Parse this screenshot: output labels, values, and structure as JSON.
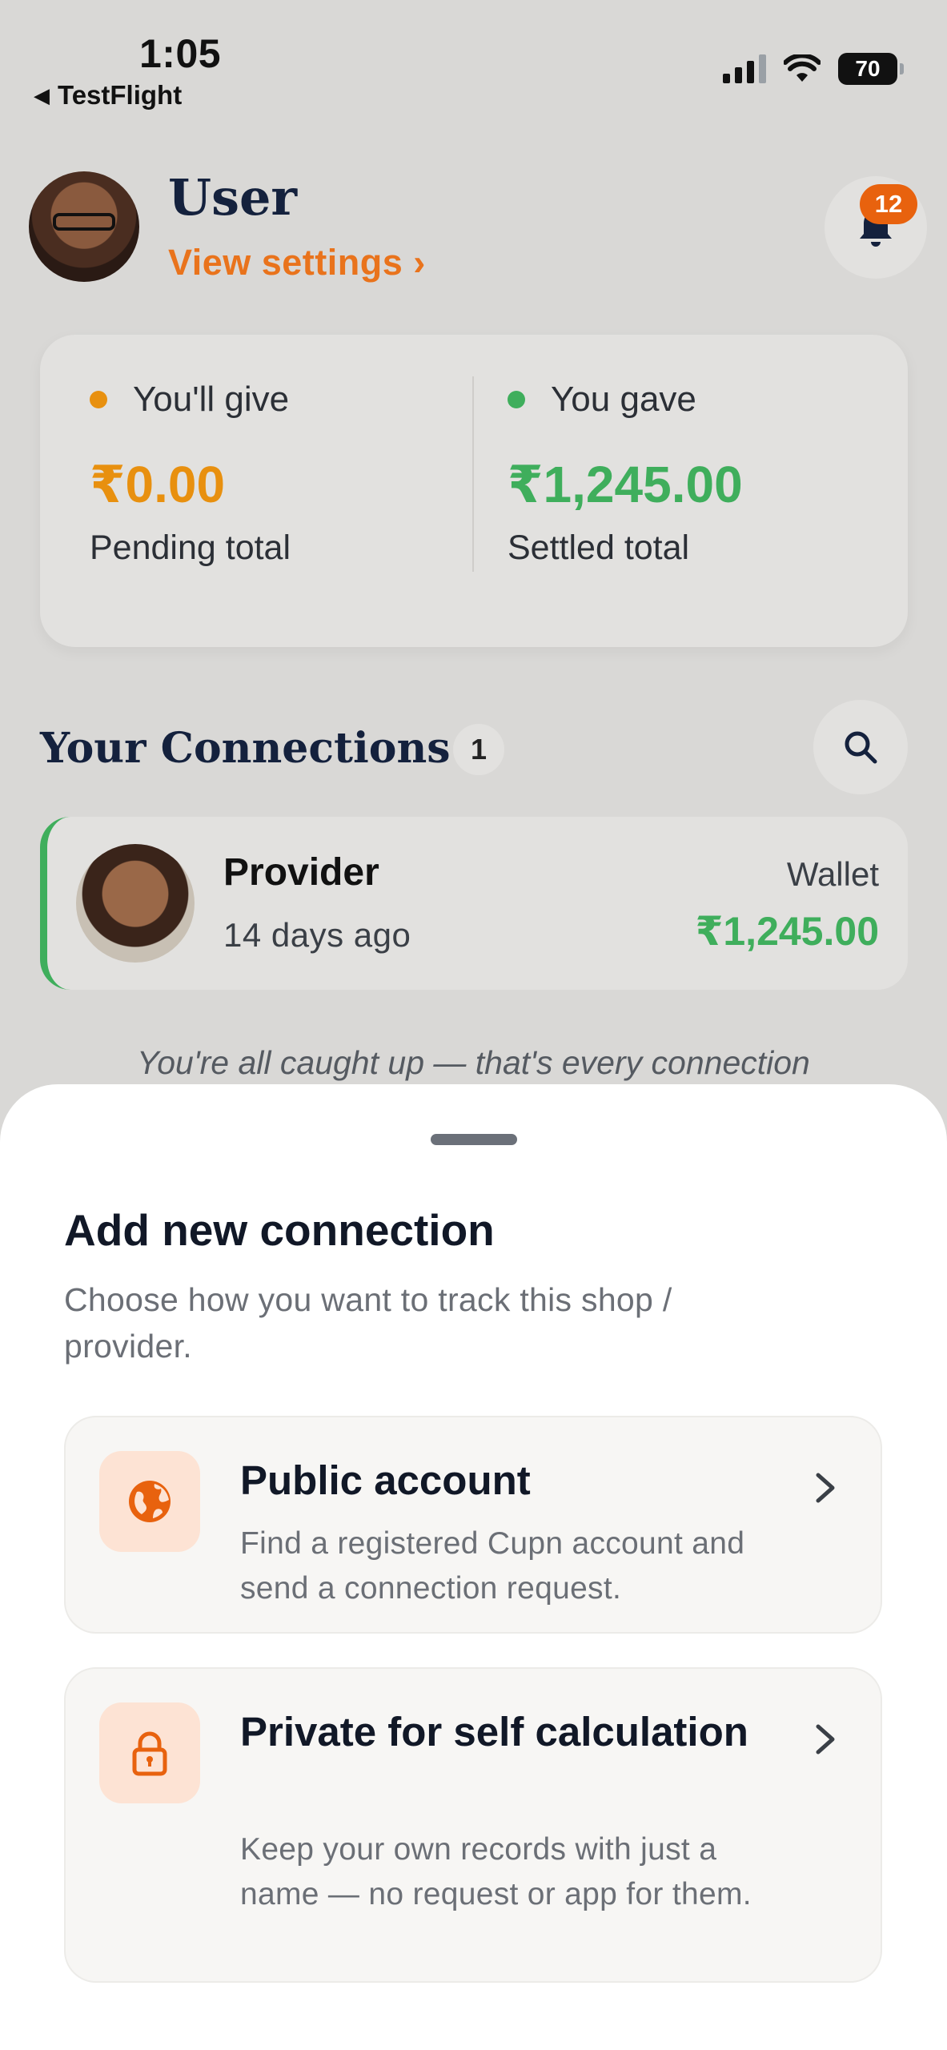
{
  "status_bar": {
    "time": "1:05",
    "back_app": "TestFlight",
    "battery": "70"
  },
  "header": {
    "user_name": "User",
    "view_settings": "View settings ›",
    "notification_count": "12"
  },
  "summary": {
    "give": {
      "label": "You'll give",
      "amount": "₹0.00",
      "sub": "Pending total",
      "color": "#e8900f"
    },
    "gave": {
      "label": "You gave",
      "amount": "₹1,245.00",
      "sub": "Settled total",
      "color": "#3fae5c"
    }
  },
  "connections": {
    "title": "Your Connections",
    "count": "1",
    "items": [
      {
        "name": "Provider",
        "time": "14 days ago",
        "wallet_label": "Wallet",
        "amount": "₹1,245.00"
      }
    ],
    "footer": "You're all caught up — that's every connection"
  },
  "sheet": {
    "title": "Add new connection",
    "subtitle": "Choose how you want to track this shop / provider.",
    "options": [
      {
        "title": "Public account",
        "desc": "Find a registered Cupn account and send a connection request.",
        "icon": "globe-icon"
      },
      {
        "title": "Private for self calculation",
        "desc": "Keep your own records with just a name — no request or app for them.",
        "icon": "lock-icon"
      }
    ]
  },
  "colors": {
    "accent": "#e9731c",
    "positive": "#3fae5c",
    "badge": "#e8620e"
  }
}
